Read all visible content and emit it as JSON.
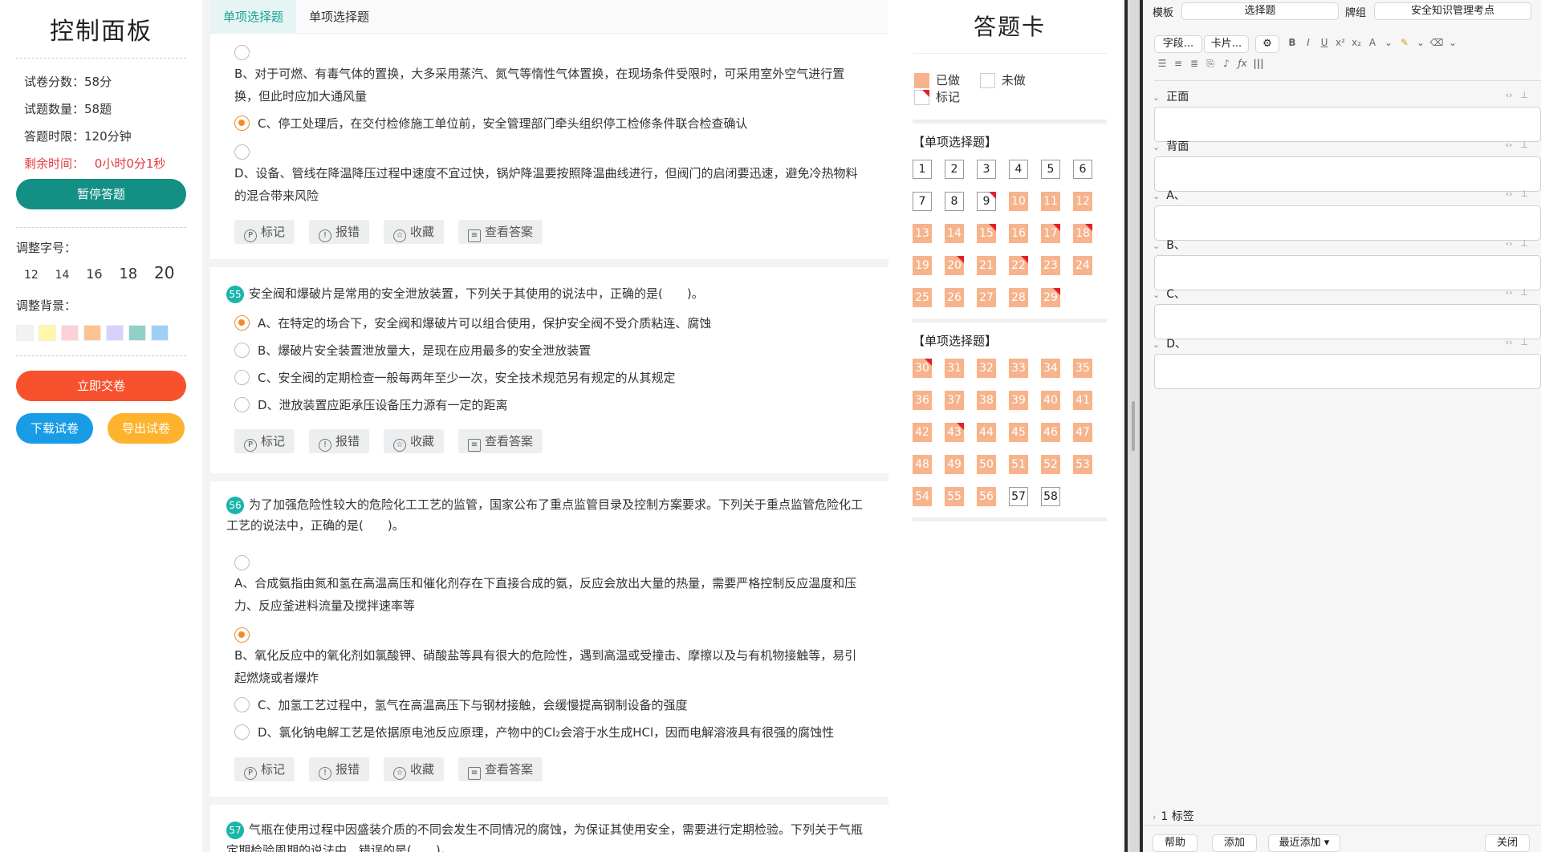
{
  "control": {
    "title": "控制面板",
    "score": "试卷分数：58分",
    "count": "试题数量：58题",
    "time_limit": "答题时限：120分钟",
    "remaining_label": "剩余时间：",
    "remaining_value": "0小时0分1秒",
    "pause_button": "暂停答题",
    "font_size_label": "调整字号：",
    "font_sizes": [
      "12",
      "14",
      "16",
      "18",
      "20"
    ],
    "bg_label": "调整背景：",
    "bg_colors": [
      "#f2f2f2",
      "#fff8a8",
      "#fcd1d6",
      "#fbc391",
      "#d6d2fb",
      "#8fd0c8",
      "#9ed0f7"
    ],
    "submit_button": "立即交卷",
    "download_button": "下载试卷",
    "export_button": "导出试卷",
    "colors": {
      "teal": "#138f83",
      "red": "#f8512d",
      "blue": "#189ce5",
      "orange": "#fdb32e"
    }
  },
  "tabs": [
    "单项选择题",
    "单项选择题"
  ],
  "question_actions": [
    "标记",
    "报错",
    "收藏",
    "查看答案"
  ],
  "q54": {
    "opt_a": "",
    "opt_b": "B、对于可燃、有毒气体的置换，大多采用蒸汽、氮气等惰性气体置换，在现场条件受限时，可采用室外空气进行置换，但此时应加大通风量",
    "opt_c": "C、停工处理后，在交付检修施工单位前，安全管理部门牵头组织停工检修条件联合检查确认",
    "opt_d": "D、设备、管线在降温降压过程中速度不宜过快，锅炉降温要按照降温曲线进行，但阀门的启闭要迅速，避免冷热物料的混合带来风险"
  },
  "q55": {
    "num": "55",
    "stem": "安全阀和爆破片是常用的安全泄放装置，下列关于其使用的说法中，正确的是(　　)。",
    "opt_a": "A、在特定的场合下，安全阀和爆破片可以组合使用，保护安全阀不受介质粘连、腐蚀",
    "opt_b": "B、爆破片安全装置泄放量大，是现在应用最多的安全泄放装置",
    "opt_c": "C、安全阀的定期检查一般每两年至少一次，安全技术规范另有规定的从其规定",
    "opt_d": "D、泄放装置应距承压设备压力源有一定的距离"
  },
  "q56": {
    "num": "56",
    "stem": "为了加强危险性较大的危险化工工艺的监管，国家公布了重点监管目录及控制方案要求。下列关于重点监管危险化工工艺的说法中，正确的是(　　)。",
    "opt_a": "A、合成氨指由氮和氢在高温高压和催化剂存在下直接合成的氨，反应会放出大量的热量，需要严格控制反应温度和压力、反应釜进料流量及搅拌速率等",
    "opt_b": "B、氧化反应中的氧化剂如氯酸钾、硝酸盐等具有很大的危险性，遇到高温或受撞击、摩擦以及与有机物接触等，易引起燃烧或者爆炸",
    "opt_c": "C、加氢工艺过程中，氢气在高温高压下与钢材接触，会缓慢提高钢制设备的强度",
    "opt_d": "D、氯化钠电解工艺是依据原电池反应原理，产物中的Cl₂会溶于水生成HCl，因而电解溶液具有很强的腐蚀性"
  },
  "q57": {
    "num": "57",
    "stem": "气瓶在使用过程中因盛装介质的不同会发生不同情况的腐蚀，为保证其使用安全，需要进行定期检验。下列关于气瓶定期检验周期的说法中，错误的是(　　)。"
  },
  "answer_card": {
    "title": "答题卡",
    "legend": [
      "已做",
      "未做",
      "标记"
    ],
    "sections": [
      {
        "title": "【单项选择题】",
        "cells": [
          {
            "n": "1",
            "s": "u",
            "m": false
          },
          {
            "n": "2",
            "s": "u",
            "m": false
          },
          {
            "n": "3",
            "s": "u",
            "m": false
          },
          {
            "n": "4",
            "s": "u",
            "m": false
          },
          {
            "n": "5",
            "s": "u",
            "m": false
          },
          {
            "n": "6",
            "s": "u",
            "m": false
          },
          {
            "n": "7",
            "s": "u",
            "m": false
          },
          {
            "n": "8",
            "s": "u",
            "m": false
          },
          {
            "n": "9",
            "s": "u",
            "m": true
          },
          {
            "n": "10",
            "s": "d",
            "m": false
          },
          {
            "n": "11",
            "s": "d",
            "m": false
          },
          {
            "n": "12",
            "s": "d",
            "m": false
          },
          {
            "n": "13",
            "s": "d",
            "m": false
          },
          {
            "n": "14",
            "s": "d",
            "m": false
          },
          {
            "n": "15",
            "s": "d",
            "m": true
          },
          {
            "n": "16",
            "s": "d",
            "m": false
          },
          {
            "n": "17",
            "s": "d",
            "m": true
          },
          {
            "n": "18",
            "s": "d",
            "m": true
          },
          {
            "n": "19",
            "s": "d",
            "m": false
          },
          {
            "n": "20",
            "s": "d",
            "m": true
          },
          {
            "n": "21",
            "s": "d",
            "m": false
          },
          {
            "n": "22",
            "s": "d",
            "m": true
          },
          {
            "n": "23",
            "s": "d",
            "m": false
          },
          {
            "n": "24",
            "s": "d",
            "m": false
          },
          {
            "n": "25",
            "s": "d",
            "m": false
          },
          {
            "n": "26",
            "s": "d",
            "m": false
          },
          {
            "n": "27",
            "s": "d",
            "m": false
          },
          {
            "n": "28",
            "s": "d",
            "m": false
          },
          {
            "n": "29",
            "s": "d",
            "m": true
          }
        ]
      },
      {
        "title": "【单项选择题】",
        "cells": [
          {
            "n": "30",
            "s": "d",
            "m": true
          },
          {
            "n": "31",
            "s": "d",
            "m": false
          },
          {
            "n": "32",
            "s": "d",
            "m": false
          },
          {
            "n": "33",
            "s": "d",
            "m": false
          },
          {
            "n": "34",
            "s": "d",
            "m": false
          },
          {
            "n": "35",
            "s": "d",
            "m": false
          },
          {
            "n": "36",
            "s": "d",
            "m": false
          },
          {
            "n": "37",
            "s": "d",
            "m": false
          },
          {
            "n": "38",
            "s": "d",
            "m": false
          },
          {
            "n": "39",
            "s": "d",
            "m": false
          },
          {
            "n": "40",
            "s": "d",
            "m": false
          },
          {
            "n": "41",
            "s": "d",
            "m": false
          },
          {
            "n": "42",
            "s": "d",
            "m": false
          },
          {
            "n": "43",
            "s": "d",
            "m": true
          },
          {
            "n": "44",
            "s": "d",
            "m": false
          },
          {
            "n": "45",
            "s": "d",
            "m": false
          },
          {
            "n": "46",
            "s": "d",
            "m": false
          },
          {
            "n": "47",
            "s": "d",
            "m": false
          },
          {
            "n": "48",
            "s": "d",
            "m": false
          },
          {
            "n": "49",
            "s": "d",
            "m": false
          },
          {
            "n": "50",
            "s": "d",
            "m": false
          },
          {
            "n": "51",
            "s": "d",
            "m": false
          },
          {
            "n": "52",
            "s": "d",
            "m": false
          },
          {
            "n": "53",
            "s": "d",
            "m": false
          },
          {
            "n": "54",
            "s": "d",
            "m": false
          },
          {
            "n": "55",
            "s": "d",
            "m": false
          },
          {
            "n": "56",
            "s": "d",
            "m": false
          },
          {
            "n": "57",
            "s": "u",
            "m": false
          },
          {
            "n": "58",
            "s": "u",
            "m": false
          }
        ]
      }
    ]
  },
  "anki": {
    "template_label": "模板",
    "template_value": "选择题",
    "deck_label": "牌组",
    "deck_value": "安全知识管理考点",
    "fields_button": "字段...",
    "cards_button": "卡片...",
    "fields": [
      "正面",
      "背面",
      "A、",
      "B、",
      "C、",
      "D、"
    ],
    "tags": "1 标签",
    "help": "帮助",
    "add": "添加",
    "history": "最近添加",
    "close": "关闭"
  }
}
